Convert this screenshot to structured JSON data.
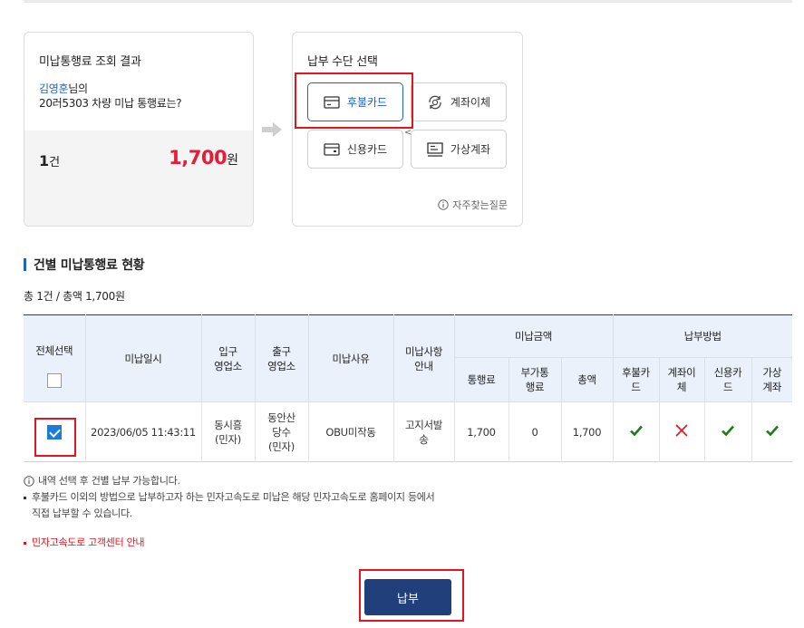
{
  "result": {
    "title": "미납통행료 조회 결과",
    "user_name": "김영훈",
    "name_suffix": "님의",
    "vehicle_line": "20러5303 차량 미납 통행료는?",
    "count_num": "1",
    "count_unit": "건",
    "amount": "1,700",
    "amount_unit": "원"
  },
  "methods": {
    "title": "납부 수단 선택",
    "options": [
      {
        "label": "후불카드",
        "icon": "card-icon"
      },
      {
        "label": "계좌이체",
        "icon": "transfer-icon"
      },
      {
        "label": "신용카드",
        "icon": "credit-card-icon"
      },
      {
        "label": "가상계좌",
        "icon": "virtual-account-icon"
      }
    ],
    "faq": "자주찾는질문",
    "lt_glyph": "<"
  },
  "section": {
    "title": "건별 미납통행료 현황",
    "summary": "총 1건 / 총액 1,700원"
  },
  "table": {
    "headers": {
      "select_all": "전체선택",
      "date": "미납일시",
      "entry": "입구\n영업소",
      "exit": "출구\n영업소",
      "reason": "미납사유",
      "notice": "미납사항\n안내",
      "amount_group": "미납금액",
      "toll": "통행료",
      "surcharge": "부가통\n행료",
      "total": "총액",
      "method_group": "납부방법",
      "m_postpaid": "후불카\n드",
      "m_transfer": "계좌이\n체",
      "m_credit": "신용카\n드",
      "m_virtual": "가상\n계좌"
    },
    "row": {
      "date": "2023/06/05 11:43:11",
      "entry": "동시흥\n(민자)",
      "exit": "동안산\n당수\n(민자)",
      "reason": "OBU미작동",
      "notice": "고지서발\n송",
      "toll": "1,700",
      "surcharge": "0",
      "total": "1,700"
    }
  },
  "notes": {
    "info": "내역 선택 후 건별 납부 가능합니다.",
    "bullet1": "후불카드 이외의 방법으로 납부하고자 하는 민자고속도로 미납은 해당 민자고속도로 홈페이지 등에서\n직접 납부할 수 있습니다.",
    "link": "민자고속도로 고객센터 안내"
  },
  "pay_button": "납부",
  "colors": {
    "accent": "#1c63c2",
    "amount_red": "#e51c3a",
    "button": "#213f7b",
    "check_green": "#1d7a1d",
    "cross_red": "#e3141f"
  }
}
